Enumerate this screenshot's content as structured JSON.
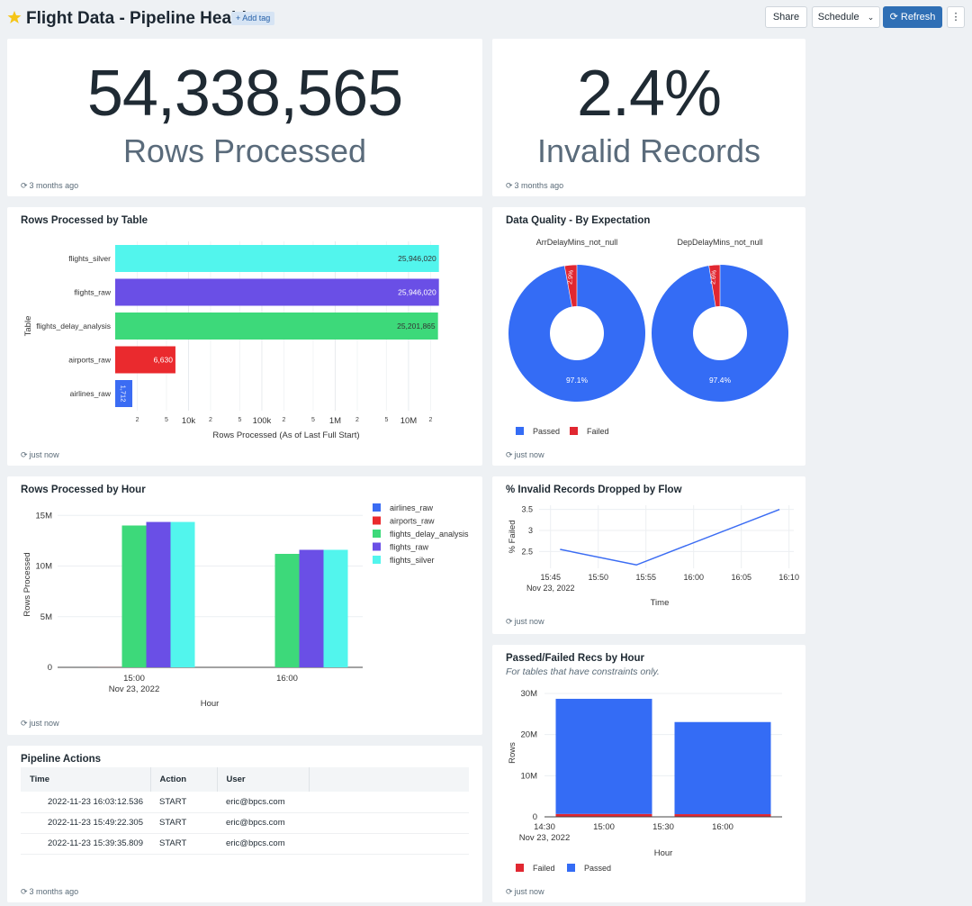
{
  "header": {
    "title": "Flight Data - Pipeline Health",
    "add_tag": "+ Add tag",
    "share": "Share",
    "schedule": "Schedule",
    "refresh": "Refresh",
    "more": "⋮",
    "star_color": "#f5c518"
  },
  "counters": [
    {
      "value": "54,338,565",
      "label": "Rows Processed",
      "updated": "3 months ago"
    },
    {
      "value": "2.4%",
      "label": "Invalid Records",
      "updated": "3 months ago"
    }
  ],
  "rows_by_table": {
    "title": "Rows Processed by Table",
    "updated": "just now",
    "chart_data": {
      "type": "bar",
      "orientation": "horizontal",
      "scale": "log",
      "categories": [
        "flights_silver",
        "flights_raw",
        "flights_delay_analysis",
        "airports_raw",
        "airlines_raw"
      ],
      "values": [
        25946020,
        25946020,
        25201865,
        6630,
        1712
      ],
      "value_labels": [
        "25,946,020",
        "25,946,020",
        "25,201,865",
        "6,630",
        "1,712"
      ],
      "colors": [
        "#52f5ed",
        "#6a4fe6",
        "#3dd97a",
        "#ea2a2e",
        "#3b6cf3"
      ],
      "xlabel": "Rows Processed (As of Last Full Start)",
      "ylabel": "Table",
      "xlim": [
        1000,
        40000000
      ],
      "major_ticks": [
        {
          "v": 10000,
          "label": "10k"
        },
        {
          "v": 100000,
          "label": "100k"
        },
        {
          "v": 1000000,
          "label": "1M"
        },
        {
          "v": 10000000,
          "label": "10M"
        }
      ],
      "minor_ticks": [
        {
          "v": 2000,
          "label": "2"
        },
        {
          "v": 5000,
          "label": "5"
        },
        {
          "v": 20000,
          "label": "2"
        },
        {
          "v": 50000,
          "label": "5"
        },
        {
          "v": 200000,
          "label": "2"
        },
        {
          "v": 500000,
          "label": "5"
        },
        {
          "v": 2000000,
          "label": "2"
        },
        {
          "v": 5000000,
          "label": "5"
        },
        {
          "v": 20000000,
          "label": "2"
        }
      ],
      "grid": true
    }
  },
  "data_quality": {
    "title": "Data Quality - By Expectation",
    "updated": "just now",
    "chart_data": [
      {
        "type": "pie",
        "title": "ArrDelayMins_not_null",
        "categories": [
          "Passed",
          "Failed"
        ],
        "values": [
          97.1,
          2.9
        ],
        "labels": [
          "97.1%",
          "2.9%"
        ]
      },
      {
        "type": "pie",
        "title": "DepDelayMins_not_null",
        "categories": [
          "Passed",
          "Failed"
        ],
        "values": [
          97.4,
          2.6
        ],
        "labels": [
          "97.4%",
          "2.6%"
        ]
      }
    ],
    "legend": [
      {
        "name": "Passed",
        "color": "#346cf5"
      },
      {
        "name": "Failed",
        "color": "#e12731"
      }
    ]
  },
  "rows_by_hour": {
    "title": "Rows Processed by Hour",
    "updated": "just now",
    "chart_data": {
      "type": "bar",
      "x": [
        "15:00",
        "16:00"
      ],
      "x_sublabel": "Nov 23, 2022",
      "series": [
        {
          "name": "airlines_raw",
          "color": "#3b6cf3",
          "values": [
            1712,
            0
          ]
        },
        {
          "name": "airports_raw",
          "color": "#ea2a2e",
          "values": [
            6630,
            0
          ]
        },
        {
          "name": "flights_delay_analysis",
          "color": "#3dd97a",
          "values": [
            14000000,
            11200000
          ]
        },
        {
          "name": "flights_raw",
          "color": "#6a4fe6",
          "values": [
            14350000,
            11600000
          ]
        },
        {
          "name": "flights_silver",
          "color": "#52f5ed",
          "values": [
            14350000,
            11600000
          ]
        }
      ],
      "xlabel": "Hour",
      "ylabel": "Rows Processed",
      "ylim": [
        0,
        16000000
      ],
      "yticks": [
        {
          "v": 0,
          "label": "0"
        },
        {
          "v": 5000000,
          "label": "5M"
        },
        {
          "v": 10000000,
          "label": "10M"
        },
        {
          "v": 15000000,
          "label": "15M"
        }
      ]
    }
  },
  "invalid_by_flow": {
    "title": "% Invalid Records Dropped by Flow",
    "updated": "just now",
    "chart_data": {
      "type": "line",
      "x": [
        "15:46",
        "15:54",
        "16:09"
      ],
      "y": [
        2.55,
        2.18,
        3.5
      ],
      "xticks": [
        "15:45",
        "15:50",
        "15:55",
        "16:00",
        "16:05",
        "16:10"
      ],
      "x_sublabel": "Nov 23, 2022",
      "xlabel": "Time",
      "ylabel": "% Failed",
      "yticks": [
        2.5,
        3,
        3.5
      ],
      "ylim": [
        2.1,
        3.6
      ],
      "color": "#3b6cf3"
    }
  },
  "passed_failed": {
    "title": "Passed/Failed Recs by Hour",
    "subtitle": "For tables that have constraints only.",
    "updated": "just now",
    "chart_data": {
      "type": "bar",
      "stacked": true,
      "x": [
        "15:00",
        "16:00"
      ],
      "xticks": [
        "14:30",
        "15:00",
        "15:30",
        "16:00"
      ],
      "x_sublabel": "Nov 23, 2022",
      "series": [
        {
          "name": "Failed",
          "color": "#e12731",
          "values": [
            700000,
            650000
          ]
        },
        {
          "name": "Passed",
          "color": "#346cf5",
          "values": [
            28000000,
            22400000
          ]
        }
      ],
      "xlabel": "Hour",
      "ylabel": "Rows",
      "ylim": [
        0,
        30000000
      ],
      "yticks": [
        {
          "v": 0,
          "label": "0"
        },
        {
          "v": 10000000,
          "label": "10M"
        },
        {
          "v": 20000000,
          "label": "20M"
        },
        {
          "v": 30000000,
          "label": "30M"
        }
      ]
    }
  },
  "pipeline_actions": {
    "title": "Pipeline Actions",
    "updated": "3 months ago",
    "columns": [
      "Time",
      "Action",
      "User"
    ],
    "rows": [
      [
        "2022-11-23 16:03:12.536",
        "START",
        "eric@bpcs.com"
      ],
      [
        "2022-11-23 15:49:22.305",
        "START",
        "eric@bpcs.com"
      ],
      [
        "2022-11-23 15:39:35.809",
        "START",
        "eric@bpcs.com"
      ]
    ]
  }
}
